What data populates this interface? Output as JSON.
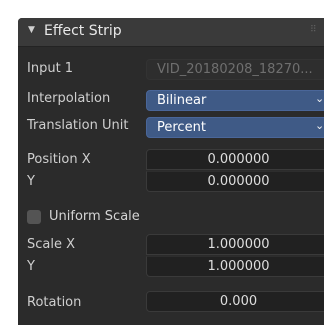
{
  "panel": {
    "title": "Effect Strip",
    "collapse_icon": "triangle-down-icon",
    "grip_icon": "drag-grip-icon"
  },
  "input1": {
    "label": "Input 1",
    "value": "VID_20180208_18270..."
  },
  "interpolation": {
    "label": "Interpolation",
    "value": "Bilinear"
  },
  "translation_unit": {
    "label": "Translation Unit",
    "value": "Percent"
  },
  "position": {
    "x_label": "Position X",
    "x_value": "0.000000",
    "y_label": "Y",
    "y_value": "0.000000"
  },
  "uniform_scale": {
    "label": "Uniform Scale",
    "checked": false
  },
  "scale": {
    "x_label": "Scale X",
    "x_value": "1.000000",
    "y_label": "Y",
    "y_value": "1.000000"
  },
  "rotation": {
    "label": "Rotation",
    "value": "0.000"
  },
  "colors": {
    "select_bg": "#3f5a86",
    "panel_bg": "#2b2b2b",
    "field_bg": "#212121"
  }
}
